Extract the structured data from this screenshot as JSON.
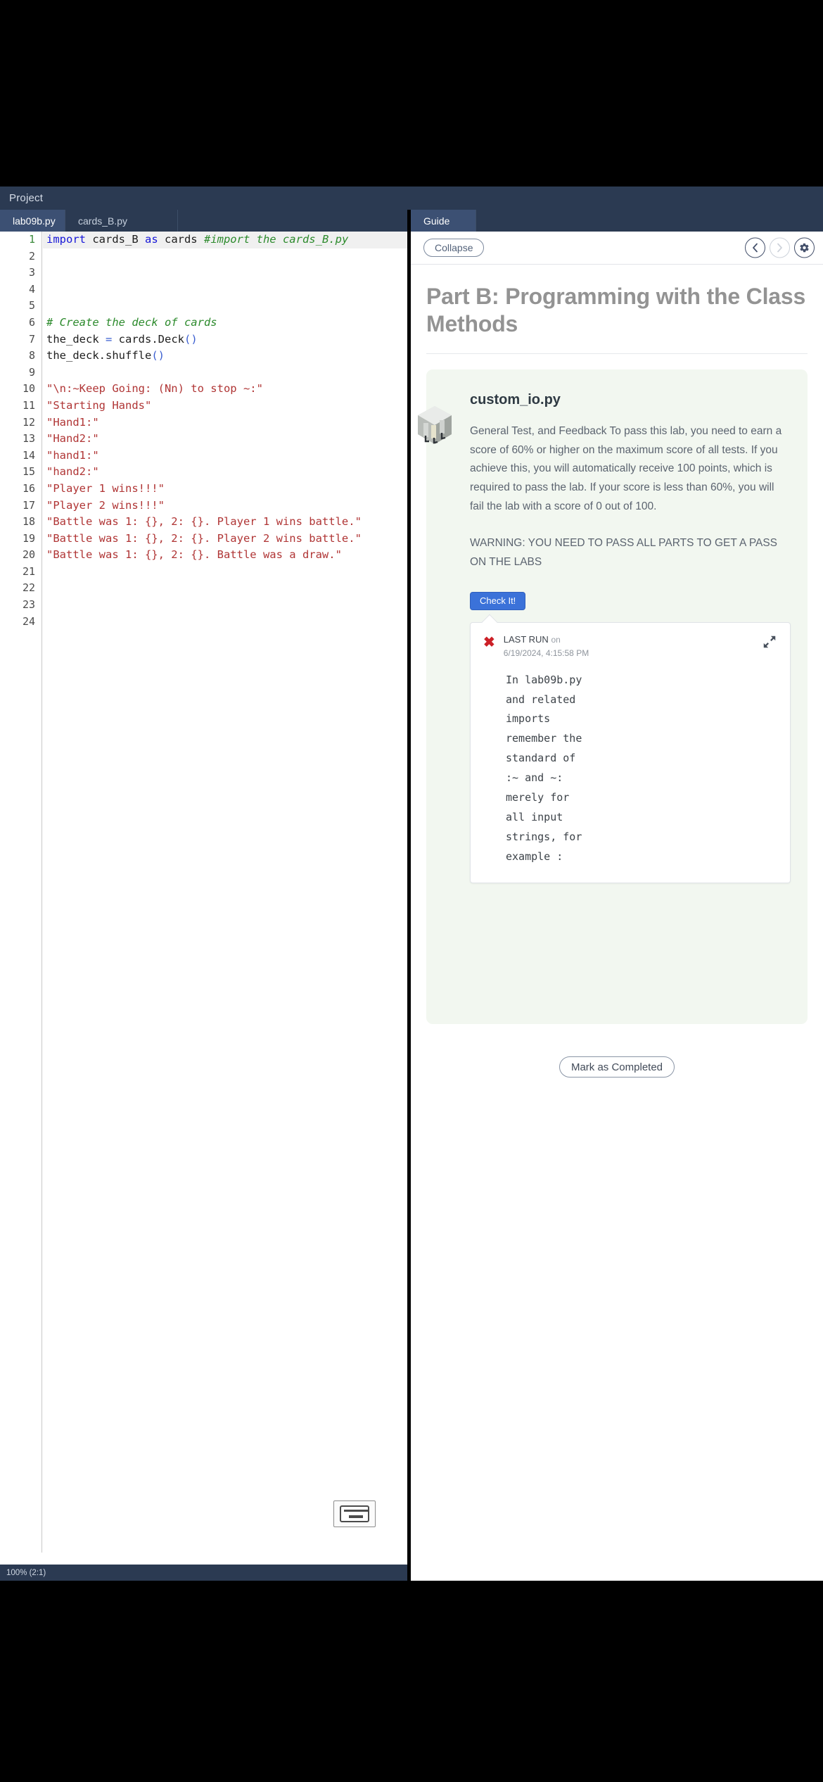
{
  "window": {
    "project_label": "Project"
  },
  "editor": {
    "tabs": [
      {
        "label": "lab09b.py",
        "active": true
      },
      {
        "label": "cards_B.py",
        "active": false
      }
    ],
    "line_numbers": [
      "1",
      "2",
      "3",
      "4",
      "5",
      "6",
      "7",
      "8",
      "9",
      "10",
      "11",
      "12",
      "13",
      "14",
      "15",
      "16",
      "17",
      "18",
      "19",
      "20",
      "21",
      "22",
      "23",
      "24"
    ],
    "lines": [
      {
        "n": 1,
        "segments": [
          {
            "t": "import ",
            "c": "kw"
          },
          {
            "t": "cards_B ",
            "c": "plain"
          },
          {
            "t": "as ",
            "c": "kw"
          },
          {
            "t": "cards ",
            "c": "plain"
          },
          {
            "t": "#import the cards_B.py",
            "c": "com"
          }
        ],
        "highlight": true
      },
      {
        "n": 2,
        "segments": []
      },
      {
        "n": 3,
        "segments": []
      },
      {
        "n": 4,
        "segments": []
      },
      {
        "n": 5,
        "segments": []
      },
      {
        "n": 6,
        "segments": [
          {
            "t": "# Create the deck of cards",
            "c": "com"
          }
        ]
      },
      {
        "n": 7,
        "segments": [
          {
            "t": "the_deck ",
            "c": "plain"
          },
          {
            "t": "= ",
            "c": "par"
          },
          {
            "t": "cards.Deck",
            "c": "plain"
          },
          {
            "t": "()",
            "c": "par"
          }
        ]
      },
      {
        "n": 8,
        "segments": [
          {
            "t": "the_deck.shuffle",
            "c": "plain"
          },
          {
            "t": "()",
            "c": "par"
          }
        ]
      },
      {
        "n": 9,
        "segments": []
      },
      {
        "n": 10,
        "segments": [
          {
            "t": "\"\\n:~Keep Going: (Nn) to stop ~:\"",
            "c": "str"
          }
        ]
      },
      {
        "n": 11,
        "segments": [
          {
            "t": "\"Starting Hands\"",
            "c": "str"
          }
        ]
      },
      {
        "n": 12,
        "segments": [
          {
            "t": "\"Hand1:\"",
            "c": "str"
          }
        ]
      },
      {
        "n": 13,
        "segments": [
          {
            "t": "\"Hand2:\"",
            "c": "str"
          }
        ]
      },
      {
        "n": 14,
        "segments": [
          {
            "t": "\"hand1:\"",
            "c": "str"
          }
        ]
      },
      {
        "n": 15,
        "segments": [
          {
            "t": "\"hand2:\"",
            "c": "str"
          }
        ]
      },
      {
        "n": 16,
        "segments": [
          {
            "t": "\"Player 1 wins!!!\"",
            "c": "str"
          }
        ]
      },
      {
        "n": 17,
        "segments": [
          {
            "t": "\"Player 2 wins!!!\"",
            "c": "str"
          }
        ]
      },
      {
        "n": 18,
        "segments": [
          {
            "t": "\"Battle was 1: {}, 2: {}. Player 1 wins battle.\"",
            "c": "str"
          }
        ]
      },
      {
        "n": 19,
        "segments": [
          {
            "t": "\"Battle was 1: {}, 2: {}. Player 2 wins battle.\"",
            "c": "str"
          }
        ]
      },
      {
        "n": 20,
        "segments": [
          {
            "t": "\"Battle was 1: {}, 2: {}. Battle was a draw.\"",
            "c": "str"
          }
        ]
      },
      {
        "n": 21,
        "segments": []
      },
      {
        "n": 22,
        "segments": []
      },
      {
        "n": 23,
        "segments": []
      },
      {
        "n": 24,
        "segments": []
      }
    ],
    "status": "100%  (2:1)",
    "keyboard_icon": "keyboard-icon"
  },
  "guide": {
    "tab_label": "Guide",
    "collapse_label": "Collapse",
    "prev_icon": "chevron-left-icon",
    "next_icon": "chevron-right-icon",
    "settings_icon": "gear-icon",
    "title": "Part B: Programming with the Class Methods",
    "card": {
      "icon": "cube-icon",
      "title": "custom_io.py",
      "paragraph_1": "General Test, and Feedback To pass this lab, you need to earn a score of 60% or higher on the maximum score of all tests. If you achieve this, you will automatically receive 100 points, which is required to pass the lab. If your score is less than 60%, you will fail the lab with a score of 0 out of 100.",
      "paragraph_2": "WARNING: YOU NEED TO PASS ALL PARTS TO GET A PASS ON THE LABS",
      "check_button": "Check It!",
      "run": {
        "status_icon": "error-x-icon",
        "label": "LAST RUN",
        "label_suffix": "on",
        "timestamp": "6/19/2024, 4:15:58 PM",
        "expand_icon": "expand-icon",
        "output": "In lab09b.py\nand related\nimports\nremember the\nstandard of\n:~ and ~:\nmerely for\nall input\nstrings, for\nexample :"
      }
    },
    "mark_completed_label": "Mark as Completed"
  },
  "colors": {
    "chrome": "#2b3a52",
    "tab_active": "#3c5073",
    "accent_blue": "#3b72d9",
    "card_bg": "#f2f7f0",
    "error_red": "#cc2027",
    "string_red": "#b03535",
    "keyword_blue": "#1616d8",
    "comment_green": "#2c8a2c"
  }
}
